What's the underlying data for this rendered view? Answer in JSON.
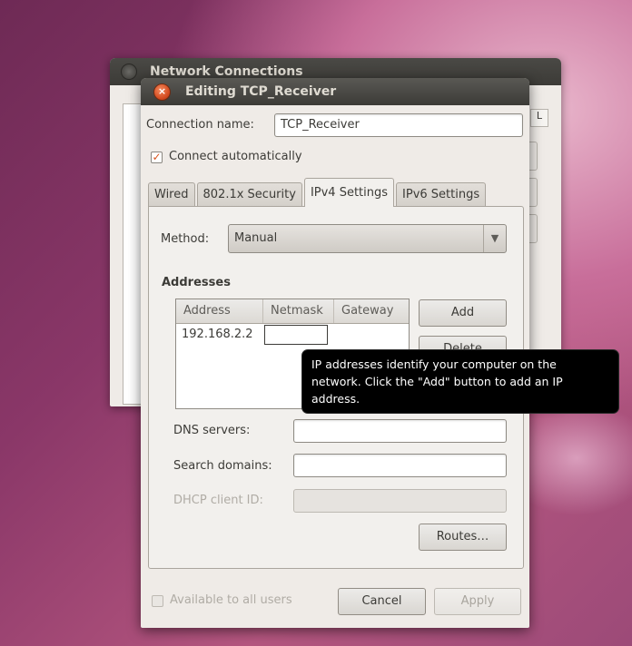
{
  "background_window": {
    "title": "Network Connections"
  },
  "dialog": {
    "title": "Editing TCP_Receiver",
    "connection_name_label": "Connection name:",
    "connection_name_value": "TCP_Receiver",
    "connect_automatically_label": "Connect automatically",
    "connect_automatically_checked": true,
    "tabs": [
      {
        "label": "Wired",
        "active": false
      },
      {
        "label": "802.1x Security",
        "active": false
      },
      {
        "label": "IPv4 Settings",
        "active": true
      },
      {
        "label": "IPv6 Settings",
        "active": false
      }
    ],
    "ipv4": {
      "method_label": "Method:",
      "method_value": "Manual",
      "addresses_heading": "Addresses",
      "table_headers": [
        "Address",
        "Netmask",
        "Gateway"
      ],
      "rows": [
        {
          "address": "192.168.2.2",
          "netmask": "",
          "gateway": ""
        }
      ],
      "add_button": "Add",
      "delete_button": "Delete",
      "dns_label": "DNS servers:",
      "dns_value": "",
      "search_domains_label": "Search domains:",
      "search_domains_value": "",
      "dhcp_client_id_label": "DHCP client ID:",
      "dhcp_client_id_value": "",
      "routes_button": "Routes…"
    },
    "available_to_all_users_label": "Available to all users",
    "available_to_all_users_checked": false,
    "cancel_button": "Cancel",
    "apply_button": "Apply"
  },
  "tooltip": {
    "text": "IP addresses identify your computer on the network.  Click the \"Add\" button to add an IP address."
  },
  "colors": {
    "title_bar": "#3c3b37",
    "window_bg": "#efebe7",
    "close_button": "#df5b26",
    "tooltip_bg": "#000000"
  }
}
